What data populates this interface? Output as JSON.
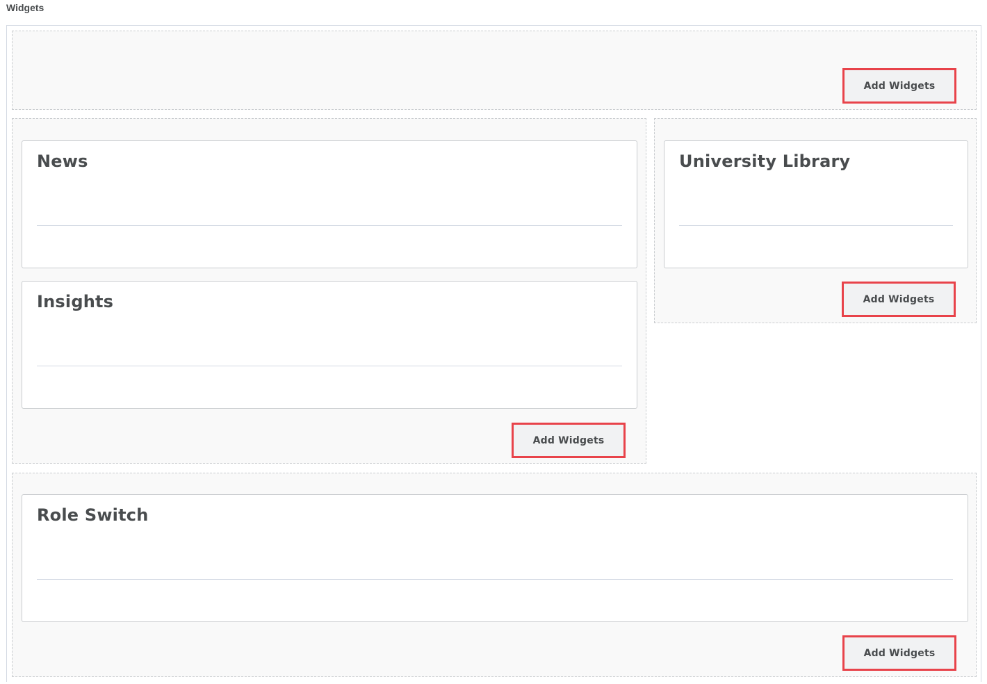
{
  "page": {
    "heading": "Widgets"
  },
  "zones": {
    "header": {
      "add_label": "Add Widgets"
    },
    "left": {
      "widgets": [
        {
          "title": "News"
        },
        {
          "title": "Insights"
        }
      ],
      "add_label": "Add Widgets"
    },
    "right": {
      "widgets": [
        {
          "title": "University Library"
        }
      ],
      "add_label": "Add Widgets"
    },
    "bottom": {
      "widgets": [
        {
          "title": "Role Switch"
        }
      ],
      "add_label": "Add Widgets"
    }
  },
  "colors": {
    "highlight_border": "#e8434a",
    "text": "#494c4e",
    "zone_background": "#f9f9f9"
  }
}
